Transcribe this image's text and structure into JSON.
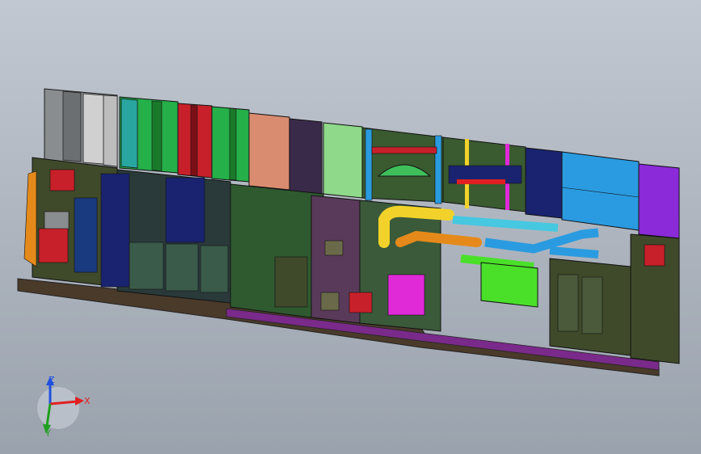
{
  "viewport": {
    "background_top": "#c2c8d1",
    "background_bottom": "#9aa2ad",
    "model_name": "air-handling-unit-assembly"
  },
  "triad": {
    "x_label": "X",
    "y_label": "Y",
    "z_label": "Z",
    "x_color": "#e02020",
    "y_color": "#20a020",
    "z_color": "#2050e0"
  },
  "palette": {
    "frame_green": "#2f5a30",
    "dark_olive": "#3f4a2a",
    "grey_panel": "#8a8d8f",
    "teal": "#2aa6a0",
    "green": "#25b04a",
    "red": "#c8202a",
    "salmon": "#d98c70",
    "light_green": "#8fd98a",
    "navy": "#1a2370",
    "blue": "#2a9be0",
    "violet": "#8a2ad8",
    "yellow": "#f2d22a",
    "orange": "#e58a1a",
    "magenta": "#e02ad8",
    "cyan": "#46c8e0",
    "lime": "#4ae02a"
  }
}
